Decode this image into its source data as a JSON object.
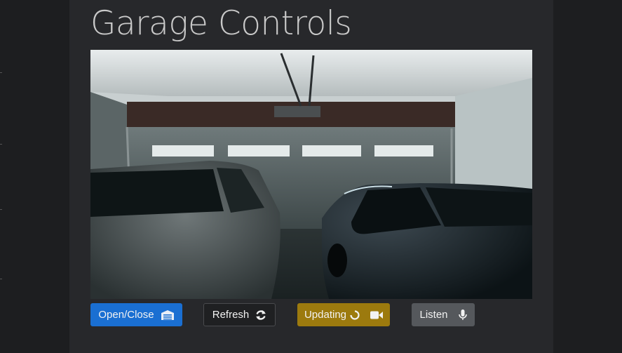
{
  "page": {
    "title": "Garage Controls"
  },
  "camera": {
    "feed_alt": "Garage camera feed"
  },
  "controls": {
    "open_close": {
      "label": "Open/Close",
      "icon": "garage-icon",
      "color": "#1a6fd2"
    },
    "refresh": {
      "label": "Refresh",
      "icon": "refresh-icon",
      "color": "#1f2022"
    },
    "updating": {
      "label": "Updating",
      "icon": "video-camera-icon",
      "spinner": "spinner-icon",
      "color": "#9c7a0e"
    },
    "listen": {
      "label": "Listen",
      "icon": "microphone-icon",
      "color": "#55585c"
    }
  }
}
